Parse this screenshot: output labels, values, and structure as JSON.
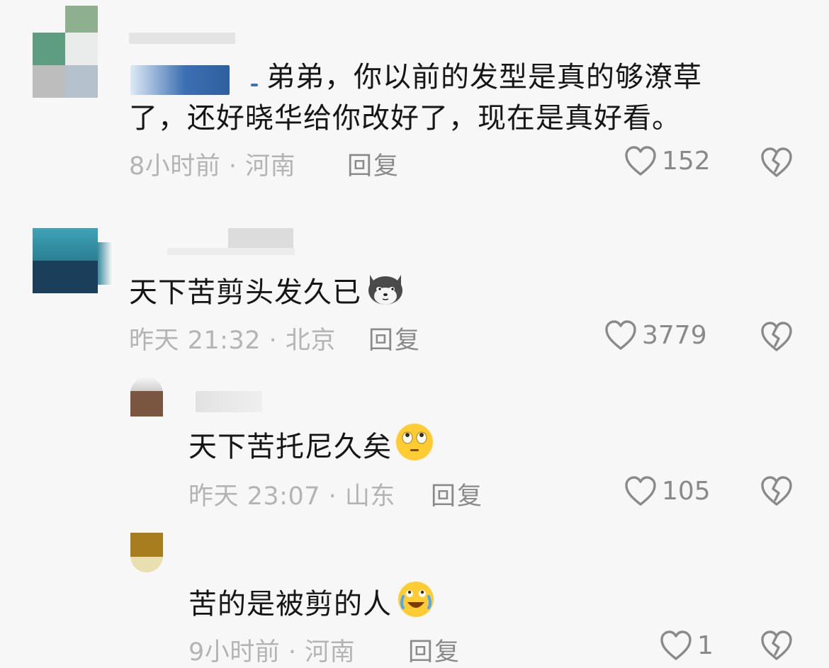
{
  "comments": [
    {
      "text_line1": "弟弟，你以前的发型是真的够潦草",
      "text_line2": "了，还好晓华给你改好了，现在是真好看。",
      "meta": "8小时前 · 河南",
      "reply_label": "回复",
      "likes": "152"
    },
    {
      "text": "天下苦剪头发久已",
      "emoji": "dog-face-emoji",
      "meta": "昨天 21:32 · 北京",
      "reply_label": "回复",
      "likes": "3779"
    },
    {
      "text": "天下苦托尼久矣",
      "emoji": "eye-roll-emoji",
      "meta": "昨天 23:07 · 山东",
      "reply_label": "回复",
      "likes": "105"
    },
    {
      "text": "苦的是被剪的人",
      "emoji": "laugh-cry-emoji",
      "meta": "9小时前 · 河南",
      "reply_label": "回复",
      "likes": "1"
    }
  ],
  "colors": {
    "background": "#f7f7f7",
    "text": "#161616",
    "meta": "#b4b4b4",
    "action": "#8a8a8a"
  },
  "icons": [
    "heart-outline-icon",
    "broken-heart-icon"
  ]
}
